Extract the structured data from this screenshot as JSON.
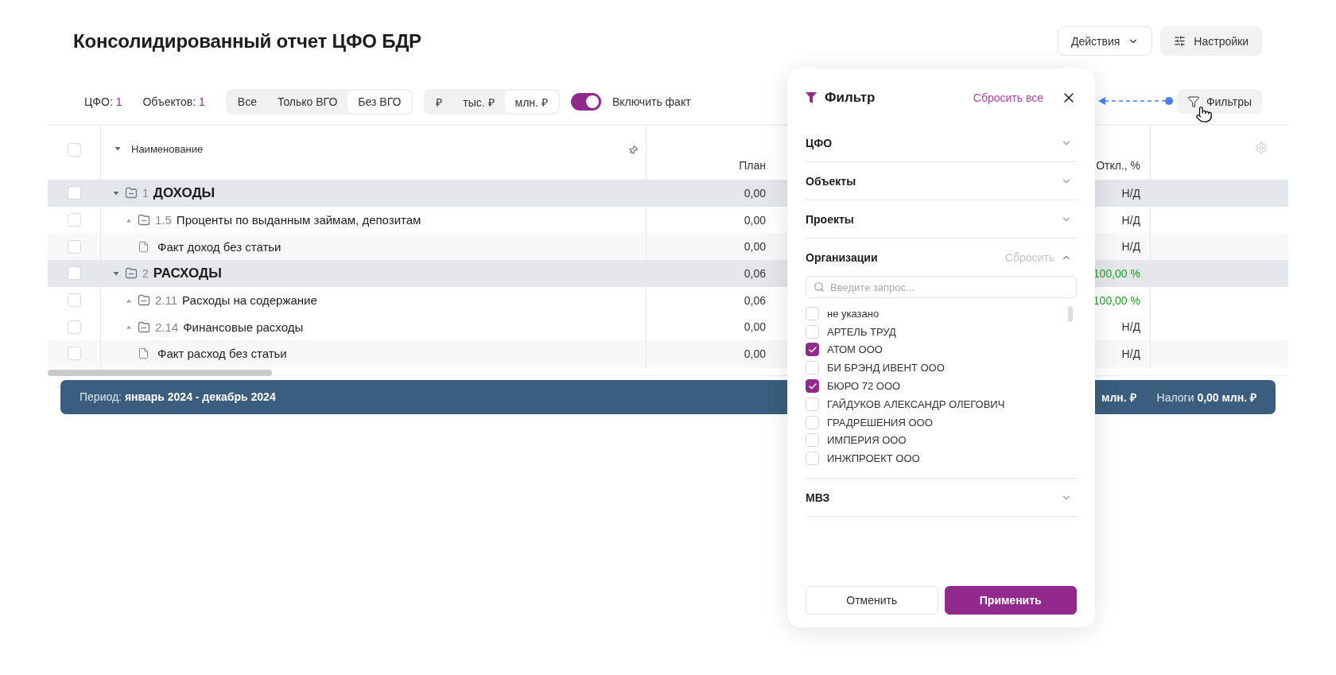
{
  "header": {
    "title": "Консолидированный отчет ЦФО БДР",
    "actions": [
      {
        "kind": "menu",
        "label": "Действия"
      },
      {
        "kind": "settings",
        "label": "Настройки"
      }
    ]
  },
  "toolbar": {
    "counters": [
      {
        "label": "ЦФО:",
        "value": "1"
      },
      {
        "label": "Объектов:",
        "value": "1"
      }
    ],
    "scope": [
      {
        "label": "Все",
        "selected": false
      },
      {
        "label": "Только ВГО",
        "selected": false
      },
      {
        "label": "Без ВГО",
        "selected": true
      }
    ],
    "units": [
      {
        "label": "₽",
        "selected": false
      },
      {
        "label": "тыс. ₽",
        "selected": false
      },
      {
        "label": "млн. ₽",
        "selected": true
      }
    ],
    "fact_toggle": {
      "label": "Включить факт",
      "on": true
    },
    "filters_button": {
      "label": "Фильтры"
    }
  },
  "table": {
    "select_all": {
      "checked": false
    },
    "columns": [
      {
        "label": "Наименование"
      },
      {
        "label": "План"
      },
      {
        "label": "Откл., %"
      }
    ],
    "rows": [
      {
        "kind": "folder",
        "code": "1",
        "name": "ДОХОДЫ",
        "plan": "0,00",
        "deviation": "Н/Д",
        "positive": false,
        "checked": false,
        "expanded": true,
        "children": [
          {
            "kind": "folder",
            "code": "1.5",
            "name": "Проценты по выданным займам, депозитам",
            "plan": "0,00",
            "deviation": "Н/Д",
            "positive": false,
            "checked": false,
            "expanded": false
          },
          {
            "kind": "file",
            "name": "Факт доход без статьи",
            "plan": "0,00",
            "deviation": "Н/Д",
            "positive": false,
            "checked": false
          }
        ]
      },
      {
        "kind": "folder",
        "code": "2",
        "name": "РАСХОДЫ",
        "plan": "0,06",
        "deviation": "100,00 %",
        "positive": true,
        "checked": false,
        "expanded": true,
        "children": [
          {
            "kind": "folder",
            "code": "2.11",
            "name": "Расходы на содержание",
            "plan": "0,06",
            "deviation": "100,00 %",
            "positive": true,
            "checked": false,
            "expanded": false
          },
          {
            "kind": "folder",
            "code": "2.14",
            "name": "Финансовые расходы",
            "plan": "0,00",
            "deviation": "Н/Д",
            "positive": false,
            "checked": false,
            "expanded": false
          },
          {
            "kind": "file",
            "name": "Факт расход без статьи",
            "plan": "0,00",
            "deviation": "Н/Д",
            "positive": false,
            "checked": false
          }
        ]
      }
    ]
  },
  "summary_bar": {
    "period_label": "Период:",
    "period_value": "январь 2024 - декабрь 2024",
    "cut_value": "млн. ₽",
    "taxes_label": "Налоги",
    "taxes_value": "0,00 млн. ₽"
  },
  "filter_panel": {
    "title": "Фильтр",
    "reset_all": "Сбросить все",
    "sections": [
      {
        "title": "ЦФО",
        "expanded": false
      },
      {
        "title": "Объекты",
        "expanded": false
      },
      {
        "title": "Проекты",
        "expanded": false
      },
      {
        "title": "Организации",
        "expanded": true,
        "reset": "Сбросить",
        "search": {
          "placeholder": "Введите запрос..."
        },
        "options": [
          {
            "label": "не указано",
            "checked": false
          },
          {
            "label": "АРТЕЛЬ ТРУД",
            "checked": false
          },
          {
            "label": "АТОМ ООО",
            "checked": true
          },
          {
            "label": "БИ БРЭНД ИВЕНТ ООО",
            "checked": false
          },
          {
            "label": "БЮРО 72 ООО",
            "checked": true
          },
          {
            "label": "ГАЙДУКОВ АЛЕКСАНДР ОЛЕГОВИЧ",
            "checked": false
          },
          {
            "label": "ГРАДРЕШЕНИЯ ООО",
            "checked": false
          },
          {
            "label": "ИМПЕРИЯ ООО",
            "checked": false
          },
          {
            "label": "ИНЖПРОЕКТ ООО",
            "checked": false
          }
        ]
      },
      {
        "title": "МВЗ",
        "expanded": false
      }
    ],
    "buttons": [
      {
        "kind": "secondary",
        "label": "Отменить"
      },
      {
        "kind": "primary",
        "label": "Применить"
      }
    ]
  }
}
